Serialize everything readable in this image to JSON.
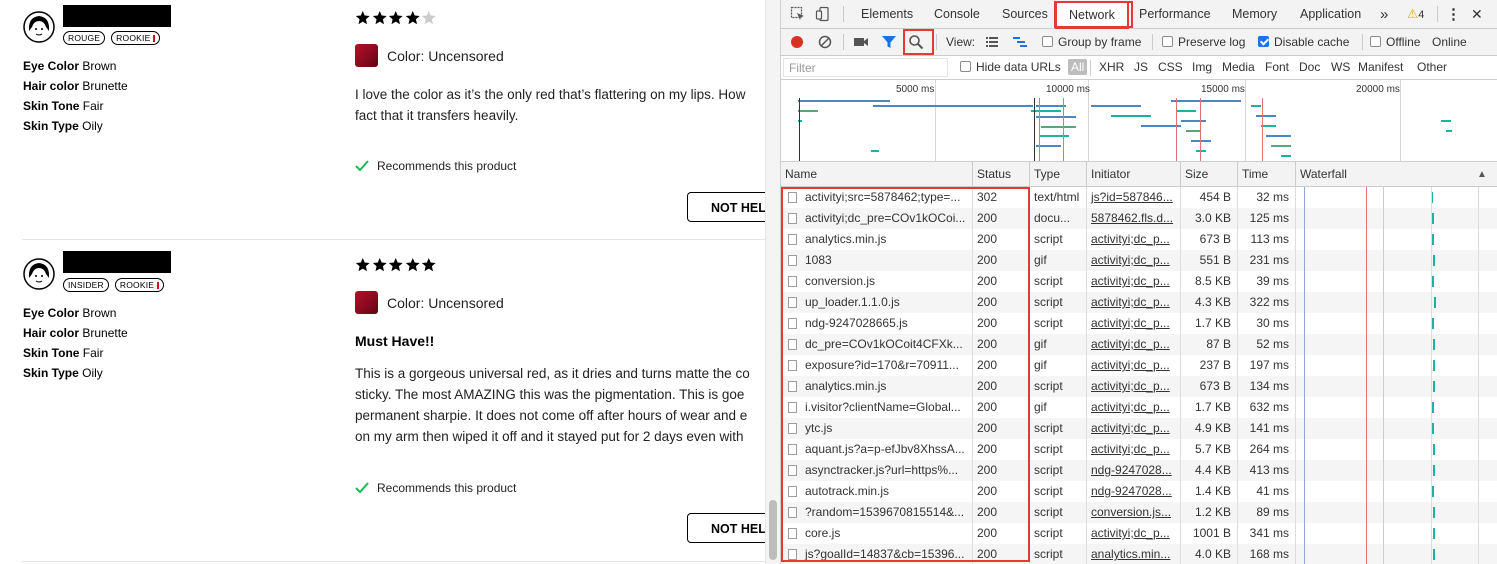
{
  "reviews": [
    {
      "badges": [
        "ROUGE",
        "ROOKIE"
      ],
      "attributes": [
        {
          "label": "Eye Color",
          "value": "Brown"
        },
        {
          "label": "Hair color",
          "value": "Brunette"
        },
        {
          "label": "Skin Tone",
          "value": "Fair"
        },
        {
          "label": "Skin Type",
          "value": "Oily"
        }
      ],
      "rating": 4,
      "color_label": "Color: Uncensored",
      "title": "",
      "text_lines": [
        "I love the color as it’s the only red that’s flattering on my lips. How",
        "fact that it transfers heavily."
      ],
      "recommend": "Recommends this product",
      "helpful_button": "NOT HEL"
    },
    {
      "badges": [
        "INSIDER",
        "ROOKIE"
      ],
      "attributes": [
        {
          "label": "Eye Color",
          "value": "Brown"
        },
        {
          "label": "Hair color",
          "value": "Brunette"
        },
        {
          "label": "Skin Tone",
          "value": "Fair"
        },
        {
          "label": "Skin Type",
          "value": "Oily"
        }
      ],
      "rating": 5,
      "color_label": "Color: Uncensored",
      "title": "Must Have!!",
      "text_lines": [
        "This is a gorgeous universal red, as it dries and turns matte the co",
        "sticky. The most AMAZING this was the pigmentation. This is goe",
        "permanent sharpie. It does not come off after hours of wear and e",
        "on my arm then wiped it off and it stayed put for 2 days even with"
      ],
      "recommend": "Recommends this product",
      "helpful_button": "NOT HEL"
    }
  ],
  "devtools": {
    "tabs": [
      "Elements",
      "Console",
      "Sources",
      "Network",
      "Performance",
      "Memory",
      "Application"
    ],
    "active_tab": "Network",
    "warnings_count": "4",
    "more_tabs": "»",
    "toolbar": {
      "view_label": "View:",
      "group_by_frame": "Group by frame",
      "preserve_log": "Preserve log",
      "disable_cache": "Disable cache",
      "offline": "Offline",
      "online": "Online"
    },
    "filter": {
      "placeholder": "Filter",
      "hide_data_urls": "Hide data URLs",
      "types": [
        "All",
        "XHR",
        "JS",
        "CSS",
        "Img",
        "Media",
        "Font",
        "Doc",
        "WS",
        "Manifest",
        "Other"
      ]
    },
    "overview_ticks": [
      "5000 ms",
      "10000 ms",
      "15000 ms",
      "20000 ms"
    ],
    "columns": [
      "Name",
      "Status",
      "Type",
      "Initiator",
      "Size",
      "Time",
      "Waterfall"
    ],
    "sort_indicator": "▲",
    "rows": [
      {
        "name": "activityi;src=5878462;type=...",
        "status": "302",
        "type": "text/html",
        "initiator": "js?id=587846...",
        "size": "454 B",
        "time": "32 ms"
      },
      {
        "name": "activityi;dc_pre=COv1kOCoi...",
        "status": "200",
        "type": "docu...",
        "initiator": "5878462.fls.d...",
        "size": "3.0 KB",
        "time": "125 ms"
      },
      {
        "name": "analytics.min.js",
        "status": "200",
        "type": "script",
        "initiator": "activityi;dc_p...",
        "size": "673 B",
        "time": "113 ms"
      },
      {
        "name": "1083",
        "status": "200",
        "type": "gif",
        "initiator": "activityi;dc_p...",
        "size": "551 B",
        "time": "231 ms"
      },
      {
        "name": "conversion.js",
        "status": "200",
        "type": "script",
        "initiator": "activityi;dc_p...",
        "size": "8.5 KB",
        "time": "39 ms"
      },
      {
        "name": "up_loader.1.1.0.js",
        "status": "200",
        "type": "script",
        "initiator": "activityi;dc_p...",
        "size": "4.3 KB",
        "time": "322 ms"
      },
      {
        "name": "ndg-9247028665.js",
        "status": "200",
        "type": "script",
        "initiator": "activityi;dc_p...",
        "size": "1.7 KB",
        "time": "30 ms"
      },
      {
        "name": "dc_pre=COv1kOCoit4CFXk...",
        "status": "200",
        "type": "gif",
        "initiator": "activityi;dc_p...",
        "size": "87 B",
        "time": "52 ms"
      },
      {
        "name": "exposure?id=170&r=70911...",
        "status": "200",
        "type": "gif",
        "initiator": "activityi;dc_p...",
        "size": "237 B",
        "time": "197 ms"
      },
      {
        "name": "analytics.min.js",
        "status": "200",
        "type": "script",
        "initiator": "activityi;dc_p...",
        "size": "673 B",
        "time": "134 ms"
      },
      {
        "name": "i.visitor?clientName=Global...",
        "status": "200",
        "type": "gif",
        "initiator": "activityi;dc_p...",
        "size": "1.7 KB",
        "time": "632 ms"
      },
      {
        "name": "ytc.js",
        "status": "200",
        "type": "script",
        "initiator": "activityi;dc_p...",
        "size": "4.9 KB",
        "time": "141 ms"
      },
      {
        "name": "aquant.js?a=p-efJbv8XhssA...",
        "status": "200",
        "type": "script",
        "initiator": "activityi;dc_p...",
        "size": "5.7 KB",
        "time": "264 ms"
      },
      {
        "name": "asynctracker.js?url=https%...",
        "status": "200",
        "type": "script",
        "initiator": "ndg-9247028...",
        "size": "4.4 KB",
        "time": "413 ms"
      },
      {
        "name": "autotrack.min.js",
        "status": "200",
        "type": "script",
        "initiator": "ndg-9247028...",
        "size": "1.4 KB",
        "time": "41 ms"
      },
      {
        "name": "?random=1539670815514&...",
        "status": "200",
        "type": "script",
        "initiator": "conversion.js...",
        "size": "1.2 KB",
        "time": "89 ms"
      },
      {
        "name": "core.js",
        "status": "200",
        "type": "script",
        "initiator": "activityi;dc_p...",
        "size": "1001 B",
        "time": "341 ms"
      },
      {
        "name": "js?goalId=14837&cb=15396...",
        "status": "200",
        "type": "script",
        "initiator": "analytics.min...",
        "size": "4.0 KB",
        "time": "168 ms"
      }
    ],
    "colors": {
      "highlight": "#e53935",
      "waterfall_bar": "#1eb2a6",
      "record": "#d93025"
    }
  }
}
